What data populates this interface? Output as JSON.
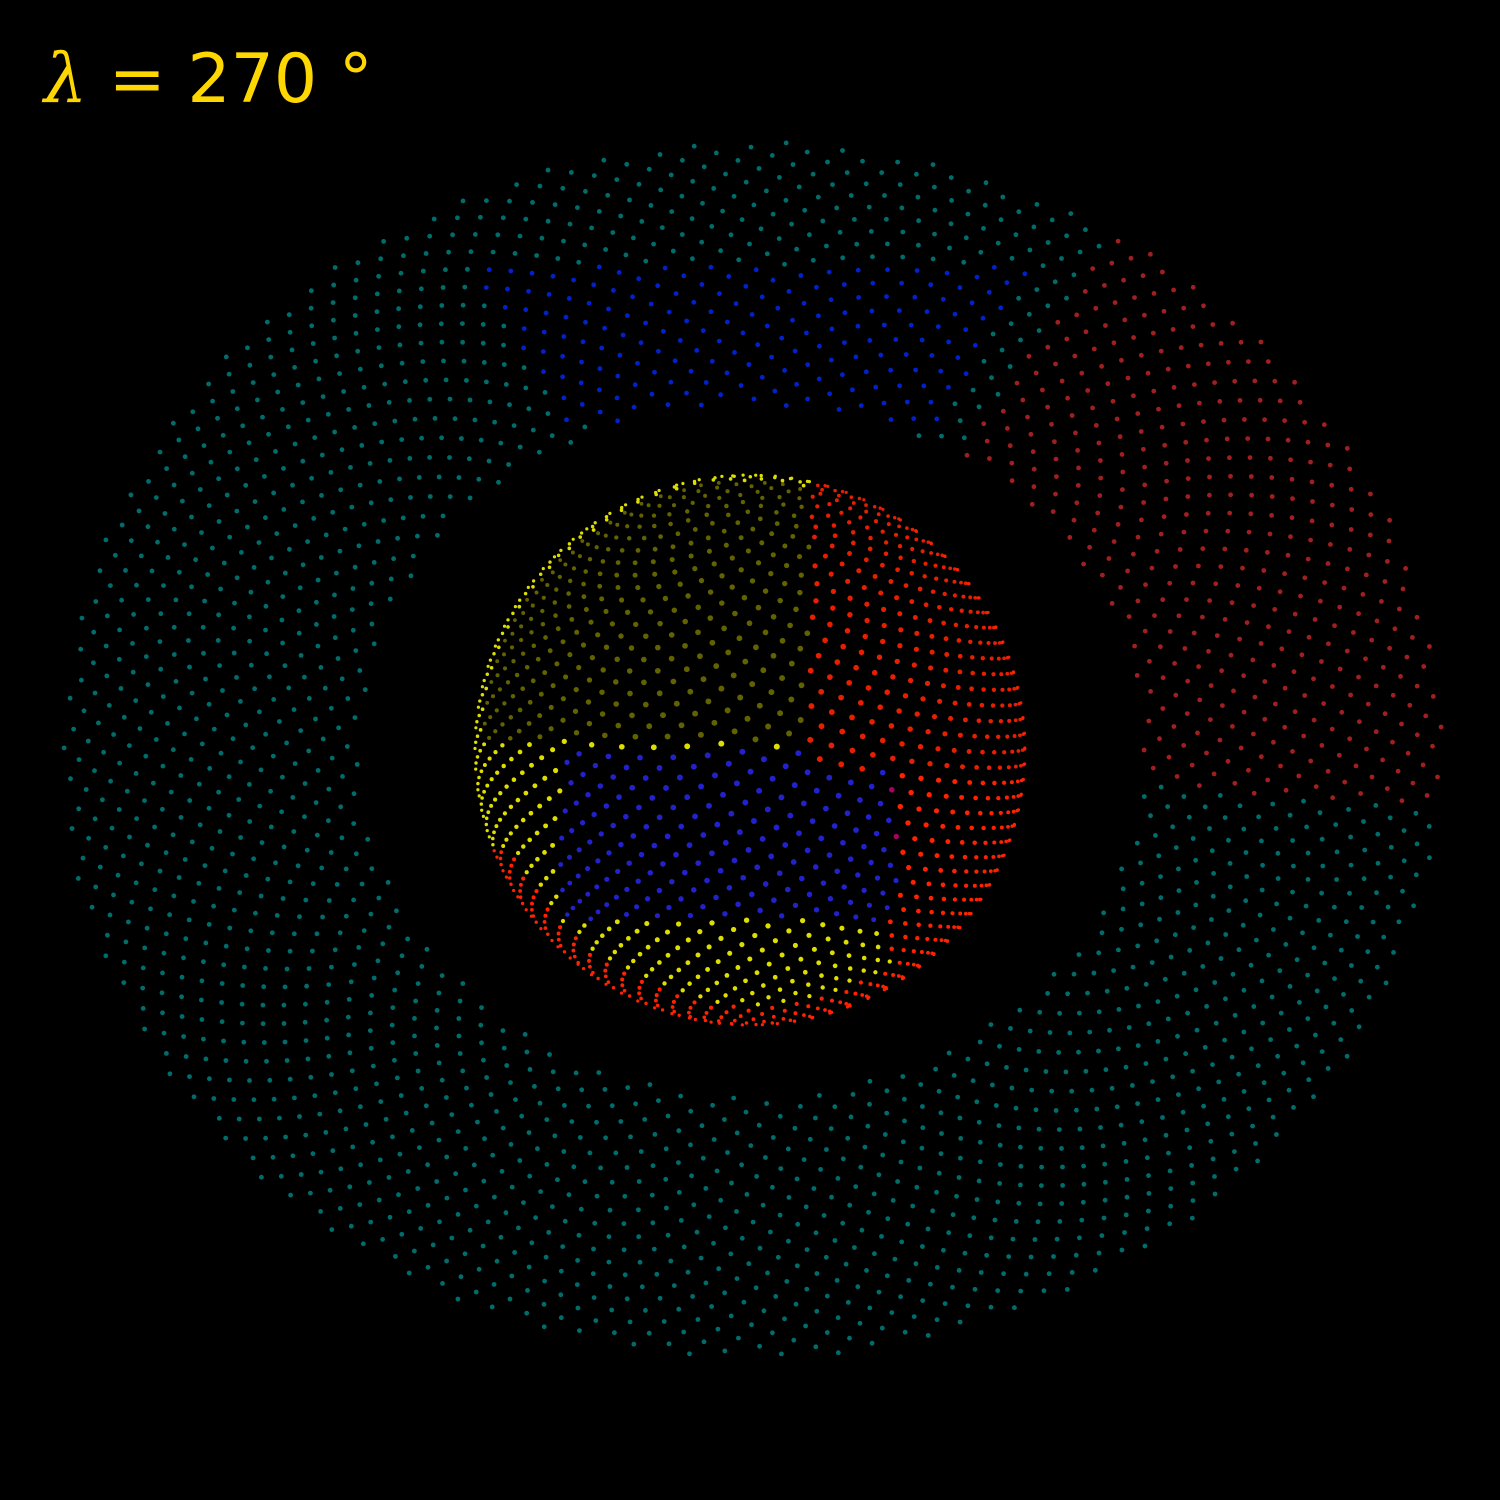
{
  "label": {
    "symbol": "λ",
    "equals": "=",
    "value": "270",
    "unit": "°",
    "color": "#ffd700"
  },
  "view": {
    "longitude_deg": 270
  },
  "colors": {
    "background": "#000000",
    "ring": "#008080",
    "ring_highlight_blue": "#0022cc",
    "ring_highlight_red": "#b22222",
    "sphere_red": "#ff2200",
    "sphere_olive": "#7a7a00",
    "sphere_yellow": "#dddd00",
    "sphere_blue": "#2222cc",
    "sphere_magenta": "#aa0066"
  }
}
